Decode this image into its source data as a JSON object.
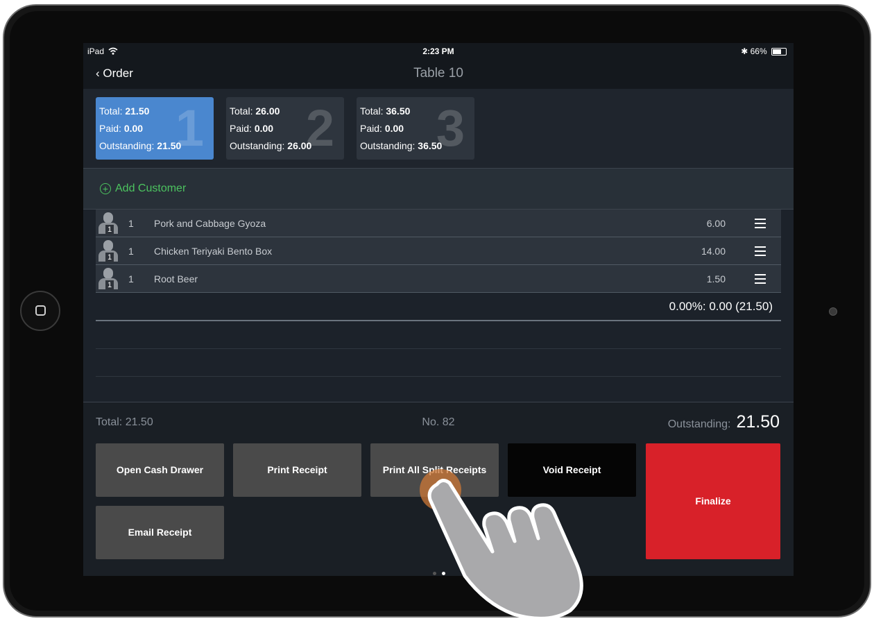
{
  "status_bar": {
    "device": "iPad",
    "time": "2:23 PM",
    "battery": "66%",
    "bluetooth": "bluetooth-icon",
    "wifi": "wifi-icon"
  },
  "nav": {
    "back_label": "Order",
    "title": "Table 10"
  },
  "splits": [
    {
      "number": "1",
      "total_label": "Total:",
      "total": "21.50",
      "paid_label": "Paid:",
      "paid": "0.00",
      "outstanding_label": "Outstanding:",
      "outstanding": "21.50",
      "active": true
    },
    {
      "number": "2",
      "total_label": "Total:",
      "total": "26.00",
      "paid_label": "Paid:",
      "paid": "0.00",
      "outstanding_label": "Outstanding:",
      "outstanding": "26.00",
      "active": false
    },
    {
      "number": "3",
      "total_label": "Total:",
      "total": "36.50",
      "paid_label": "Paid:",
      "paid": "0.00",
      "outstanding_label": "Outstanding:",
      "outstanding": "36.50",
      "active": false
    }
  ],
  "customer": {
    "add_label": "Add Customer"
  },
  "items": [
    {
      "seat": "1",
      "qty": "1",
      "name": "Pork and Cabbage Gyoza",
      "price": "6.00"
    },
    {
      "seat": "1",
      "qty": "1",
      "name": "Chicken Teriyaki Bento Box",
      "price": "14.00"
    },
    {
      "seat": "1",
      "qty": "1",
      "name": "Root Beer",
      "price": "1.50"
    }
  ],
  "discount_line": "0.00%: 0.00 (21.50)",
  "summary": {
    "total": "Total: 21.50",
    "order_no": "No. 82",
    "outstanding_label": "Outstanding:",
    "outstanding_value": "21.50"
  },
  "buttons": {
    "open_cash_drawer": "Open Cash Drawer",
    "print_receipt": "Print Receipt",
    "print_all_split": "Print All Split Receipts",
    "void_receipt": "Void Receipt",
    "finalize": "Finalize",
    "email_receipt": "Email Receipt"
  },
  "colors": {
    "active_split": "#4a87cf",
    "finalize": "#d82129",
    "add_customer": "#4cc35f"
  }
}
